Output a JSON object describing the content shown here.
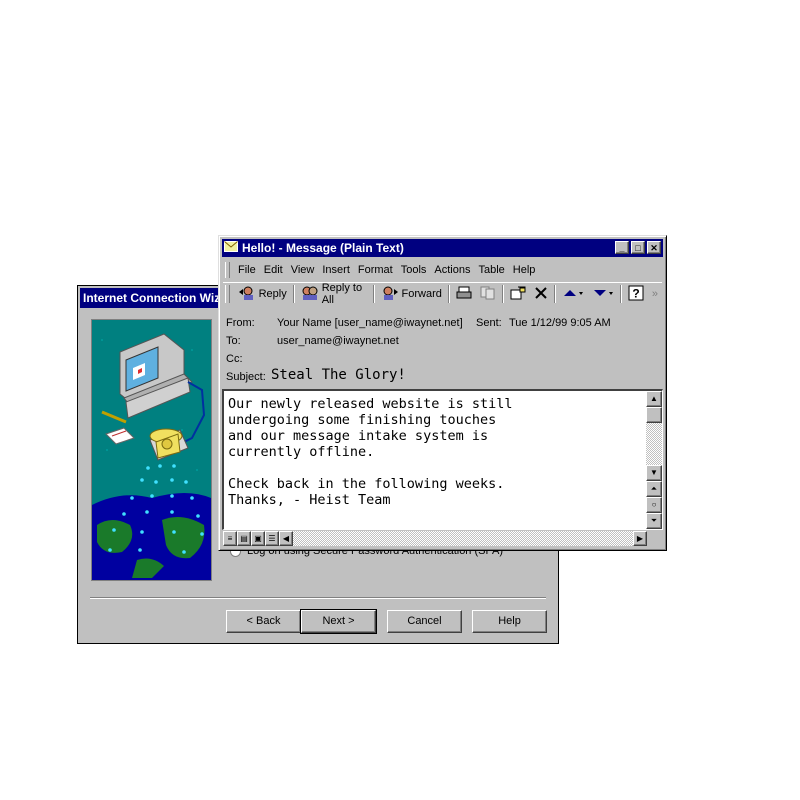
{
  "wizard": {
    "title": "Internet Connection Wiz",
    "radio_label": "Log on using Secure Password Authentication (SPA)",
    "buttons": {
      "back": "< Back",
      "next": "Next >",
      "cancel": "Cancel",
      "help": "Help"
    }
  },
  "message": {
    "title": "Hello! - Message (Plain Text)",
    "menu": [
      "File",
      "Edit",
      "View",
      "Insert",
      "Format",
      "Tools",
      "Actions",
      "Table",
      "Help"
    ],
    "toolbar": {
      "reply": "Reply",
      "reply_all": "Reply to All",
      "forward": "Forward"
    },
    "header": {
      "from_label": "From:",
      "from_value": "Your Name [user_name@iwaynet.net]",
      "sent_label": "Sent:",
      "sent_value": "Tue 1/12/99 9:05 AM",
      "to_label": "To:",
      "to_value": "user_name@iwaynet.net",
      "cc_label": "Cc:",
      "cc_value": "",
      "subject_label": "Subject:",
      "subject_value": "Steal The Glory!"
    },
    "body": "Our newly released website is still\nundergoing some finishing touches\nand our message intake system is\ncurrently offline.\n\nCheck back in the following weeks.\nThanks, - Heist Team"
  },
  "colors": {
    "titlebar": "#000080",
    "face": "#c0c0c0",
    "art_bg": "#008080"
  }
}
